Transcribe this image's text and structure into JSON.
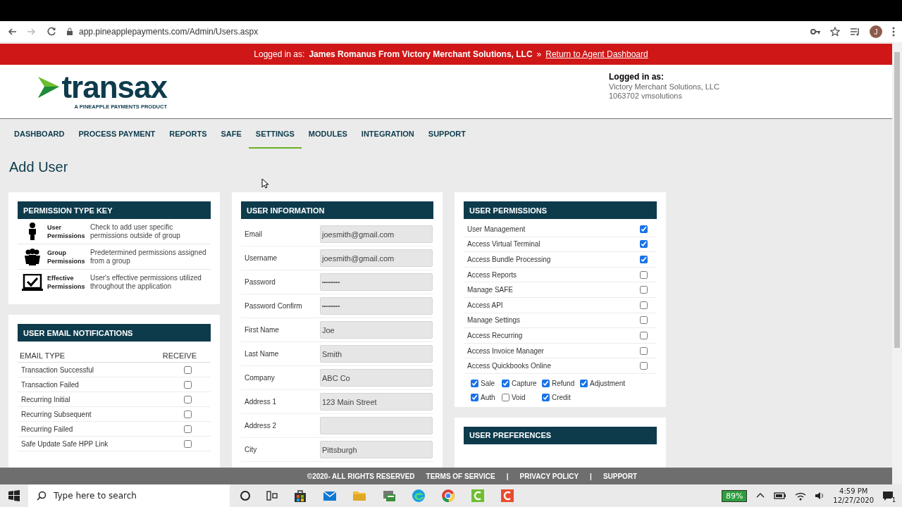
{
  "browser": {
    "url": "app.pineapplepayments.com/Admin/Users.aspx",
    "profile_initial": "J"
  },
  "banner": {
    "label": "Logged in as:",
    "user": "James Romanus From Victory Merchant Solutions, LLC",
    "separator": "»",
    "link": "Return to Agent Dashboard"
  },
  "header": {
    "logo_text": "transax",
    "logo_tagline": "A PINEAPPLE PAYMENTS PRODUCT",
    "login_label": "Logged in as:",
    "company": "Victory Merchant Solutions, LLC",
    "account": "1063702 vmsolutions"
  },
  "nav": [
    {
      "label": "DASHBOARD",
      "selected": false
    },
    {
      "label": "PROCESS PAYMENT",
      "selected": false
    },
    {
      "label": "REPORTS",
      "selected": false
    },
    {
      "label": "SAFE",
      "selected": false
    },
    {
      "label": "SETTINGS",
      "selected": true
    },
    {
      "label": "MODULES",
      "selected": false
    },
    {
      "label": "INTEGRATION",
      "selected": false
    },
    {
      "label": "SUPPORT",
      "selected": false
    }
  ],
  "page_title": "Add User",
  "permission_key": {
    "title": "PERMISSION TYPE KEY",
    "items": [
      {
        "kind": "user",
        "name": "User Permissions",
        "description": "Check to add user specific permissions outside of group"
      },
      {
        "kind": "group",
        "name": "Group Permissions",
        "description": "Predetermined permissions assigned from a group"
      },
      {
        "kind": "effective",
        "name": "Effective Permissions",
        "description": "User's effective permissions utilized throughout the application"
      }
    ]
  },
  "email_notifications": {
    "title": "USER EMAIL NOTIFICATIONS",
    "columns": [
      "EMAIL TYPE",
      "RECEIVE"
    ],
    "rows": [
      {
        "label": "Transaction Successful",
        "checked": false
      },
      {
        "label": "Transaction Failed",
        "checked": false
      },
      {
        "label": "Recurring Initial",
        "checked": false
      },
      {
        "label": "Recurring Subsequent",
        "checked": false
      },
      {
        "label": "Recurring Failed",
        "checked": false
      },
      {
        "label": "Safe Update Safe HPP Link",
        "checked": false
      }
    ]
  },
  "user_information": {
    "title": "USER INFORMATION",
    "fields": [
      {
        "label": "Email",
        "value": "joesmith@gmail.com",
        "kind": "text"
      },
      {
        "label": "Username",
        "value": "joesmith@gmail.com",
        "kind": "text"
      },
      {
        "label": "Password",
        "value": "•••••••••",
        "kind": "password"
      },
      {
        "label": "Password Confirm",
        "value": "•••••••••",
        "kind": "password"
      },
      {
        "label": "First Name",
        "value": "Joe",
        "kind": "text"
      },
      {
        "label": "Last Name",
        "value": "Smith",
        "kind": "text"
      },
      {
        "label": "Company",
        "value": "ABC Co",
        "kind": "text"
      },
      {
        "label": "Address 1",
        "value": "123 Main Street",
        "kind": "text"
      },
      {
        "label": "Address 2",
        "kind": "text"
      },
      {
        "label": "City",
        "value": "Pittsburgh",
        "kind": "text"
      }
    ]
  },
  "user_permissions": {
    "title": "USER PERMISSIONS",
    "items": [
      {
        "label": "User Management",
        "checked": true
      },
      {
        "label": "Access Virtual Terminal",
        "checked": true
      },
      {
        "label": "Access Bundle Processing",
        "checked": true
      },
      {
        "label": "Access Reports",
        "checked": false
      },
      {
        "label": "Manage SAFE",
        "checked": false
      },
      {
        "label": "Access API",
        "checked": false
      },
      {
        "label": "Manage Settings",
        "checked": false
      },
      {
        "label": "Access Recurring",
        "checked": false
      },
      {
        "label": "Access Invoice Manager",
        "checked": false
      },
      {
        "label": "Access Quickbooks Online",
        "checked": false
      }
    ],
    "actions": [
      {
        "label": "Sale",
        "checked": true
      },
      {
        "label": "Capture",
        "checked": true
      },
      {
        "label": "Refund",
        "checked": true
      },
      {
        "label": "Adjustment",
        "checked": true
      },
      {
        "label": "Auth",
        "checked": true
      },
      {
        "label": "Void",
        "checked": false
      },
      {
        "label": "Credit",
        "checked": true
      }
    ]
  },
  "user_preferences": {
    "title": "USER PREFERENCES"
  },
  "footer": {
    "copyright": "©2020- ALL RIGHTS RESERVED",
    "separator": "|",
    "links": [
      "TERMS OF SERVICE",
      "PRIVACY POLICY",
      "SUPPORT"
    ]
  },
  "taskbar": {
    "search_placeholder": "Type here to search",
    "battery": "89%",
    "time": "4:59 PM",
    "date": "12/27/2020",
    "notification_count": "1"
  }
}
